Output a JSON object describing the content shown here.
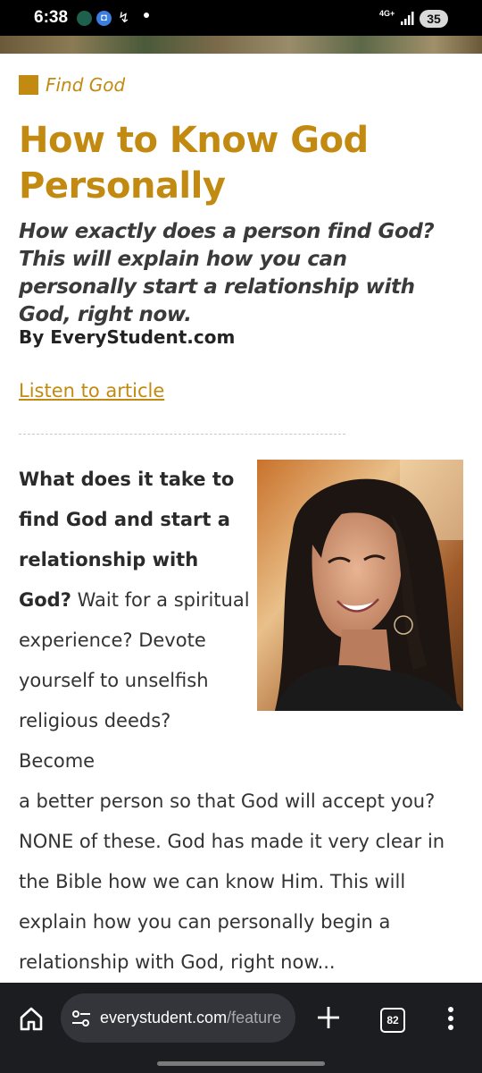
{
  "status_bar": {
    "time": "6:38",
    "network": "4G+",
    "battery": "35"
  },
  "article": {
    "category": "Find God",
    "title": "How to Know God Personally",
    "subtitle": "How exactly does a person find God? This will explain how you can personally start a relationship with God, right now.",
    "byline": "By EveryStudent.com",
    "listen_link": "Listen to article",
    "intro_lead": "What does it take to find God and start a relationship with God?",
    "intro_rest_1": "Wait for a spiritual experience? Devote yourself to unselfish religious deeds? Become",
    "intro_rest_2": "a better person so that God will accept you? NONE of these. God has made it very clear in the Bible how we can know Him. This will explain how you can personally begin a relationship with God, right now..."
  },
  "browser": {
    "url_host": "everystudent.com",
    "url_path": "/feature",
    "tab_count": "82"
  },
  "colors": {
    "accent": "#c28a10",
    "toolbar": "#1c1d21"
  },
  "icons": [
    "home-icon",
    "tune-icon",
    "plus-icon",
    "tabs-icon",
    "more-vert-icon"
  ]
}
